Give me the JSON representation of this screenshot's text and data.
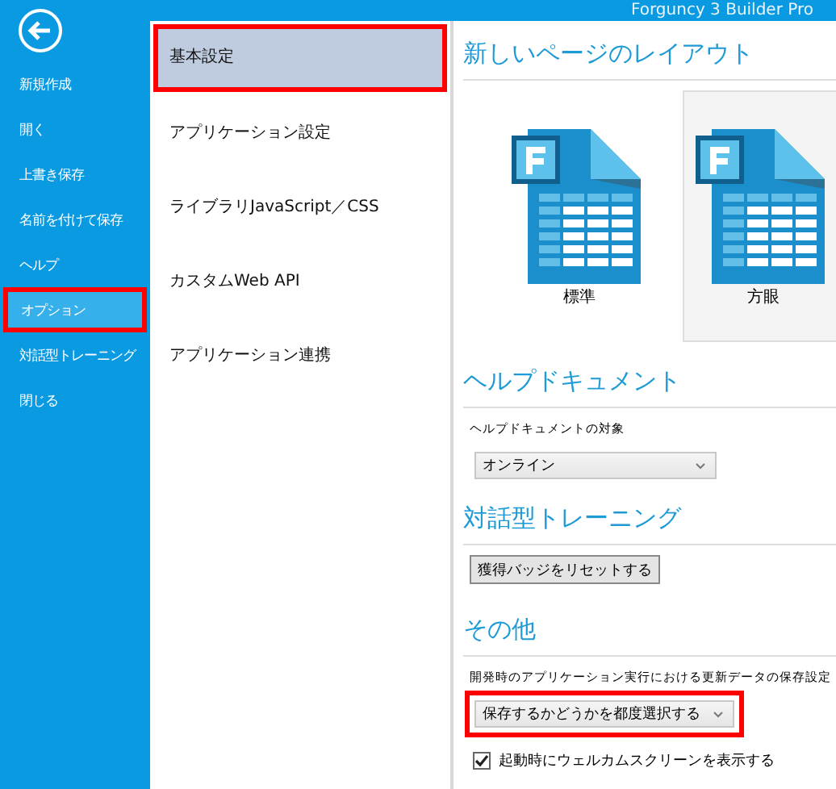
{
  "window": {
    "title": "Forguncy 3 Builder Pro"
  },
  "sidebar": {
    "items": [
      {
        "label": "新規作成",
        "selected": false,
        "highlighted": false
      },
      {
        "label": "開く",
        "selected": false,
        "highlighted": false
      },
      {
        "label": "上書き保存",
        "selected": false,
        "highlighted": false
      },
      {
        "label": "名前を付けて保存",
        "selected": false,
        "highlighted": false
      },
      {
        "label": "ヘルプ",
        "selected": false,
        "highlighted": false
      },
      {
        "label": "オプション",
        "selected": true,
        "highlighted": true
      },
      {
        "label": "対話型トレーニング",
        "selected": false,
        "highlighted": false
      },
      {
        "label": "閉じる",
        "selected": false,
        "highlighted": false
      }
    ]
  },
  "categories": [
    {
      "label": "基本設定",
      "selected": true,
      "highlighted": true
    },
    {
      "label": "アプリケーション設定",
      "selected": false,
      "highlighted": false
    },
    {
      "label": "ライブラリJavaScript／CSS",
      "selected": false,
      "highlighted": false
    },
    {
      "label": "カスタムWeb API",
      "selected": false,
      "highlighted": false
    },
    {
      "label": "アプリケーション連携",
      "selected": false,
      "highlighted": false
    }
  ],
  "sections": [
    {
      "heading": "新しいページのレイアウト",
      "controls": [
        {
          "kind": "layouts",
          "items": [
            {
              "label": "標準",
              "selected": false
            },
            {
              "label": "方眼",
              "selected": true
            }
          ]
        }
      ]
    },
    {
      "heading": "ヘルプドキュメント",
      "controls": [
        {
          "kind": "dropdown",
          "label": "ヘルプドキュメントの対象",
          "value": "オンライン"
        }
      ]
    },
    {
      "heading": "対話型トレーニング",
      "controls": [
        {
          "kind": "button",
          "label": "獲得バッジをリセットする"
        }
      ]
    },
    {
      "heading": "その他",
      "controls": [
        {
          "kind": "dropdown",
          "label": "開発時のアプリケーション実行における更新データの保存設定",
          "value": "保存するかどうかを都度選択する",
          "highlighted": true
        },
        {
          "kind": "checkbox",
          "label": "起動時にウェルカムスクリーンを表示する",
          "checked": true
        }
      ]
    }
  ]
}
